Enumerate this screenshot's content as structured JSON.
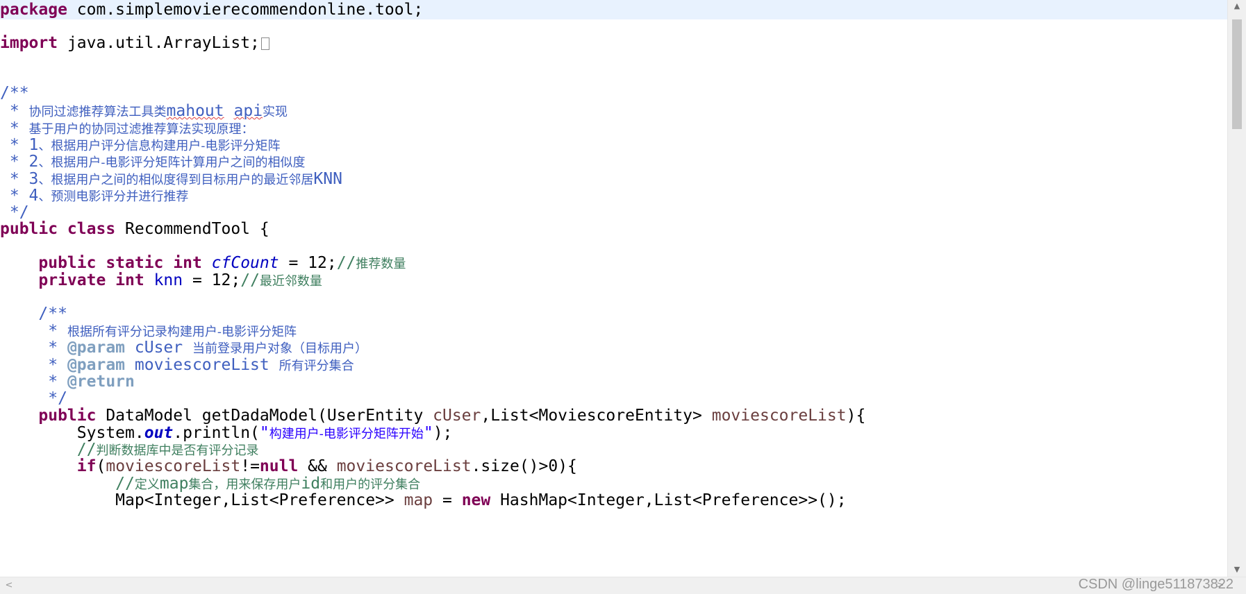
{
  "code": {
    "package_kw": "package",
    "package_name": " com.simplemovierecommendonline.tool;",
    "import_kw": "import",
    "import_name": " java.util.ArrayList;",
    "doc_open": "/**",
    "doc_line1_prefix": " * ",
    "doc_line1_cjk1": "协同过滤推荐算法工具类",
    "doc_line1_word1": "mahout",
    "doc_line1_space": " ",
    "doc_line1_word2": "api",
    "doc_line1_cjk2": "实现",
    "doc_line2_prefix": " * ",
    "doc_line2_cjk": "基于用户的协同过滤推荐算法实现原理：",
    "doc_line3_prefix": " * 1",
    "doc_line3_cjk": "、根据用户评分信息构建用户-电影评分矩阵",
    "doc_line4_prefix": " * 2",
    "doc_line4_cjk": "、根据用户-电影评分矩阵计算用户之间的相似度",
    "doc_line5_prefix": " * 3",
    "doc_line5_cjk": "、根据用户之间的相似度得到目标用户的最近邻居",
    "doc_line5_suffix": "KNN",
    "doc_line6_prefix": " * 4",
    "doc_line6_cjk": "、预测电影评分并进行推荐",
    "doc_close": " */",
    "class_kw": "public class",
    "class_name": " RecommendTool {",
    "field1_kw": "public static int",
    "field1_name": "cfCount",
    "field1_rest": " = 12;",
    "field1_comment_slash": "//",
    "field1_comment": "推荐数量",
    "field2_kw": "private int",
    "field2_name": "knn",
    "field2_rest": " = 12;",
    "field2_comment_slash": "//",
    "field2_comment": "最近邻数量",
    "mdoc_open": "/**",
    "mdoc_line1_prefix": " * ",
    "mdoc_line1_cjk": "根据所有评分记录构建用户-电影评分矩阵",
    "mdoc_param1_star": " * ",
    "mdoc_param1_tag": "@param",
    "mdoc_param1_name": " cUser ",
    "mdoc_param1_desc": "当前登录用户对象（目标用户）",
    "mdoc_param2_star": " * ",
    "mdoc_param2_tag": "@param",
    "mdoc_param2_name": " moviescoreList ",
    "mdoc_param2_desc": "所有评分集合",
    "mdoc_return_star": " * ",
    "mdoc_return_tag": "@return",
    "mdoc_close": " */",
    "method_kw": "public",
    "method_sig1": " DataModel getDadaModel(UserEntity ",
    "method_param1": "cUser",
    "method_sig2": ",List<MoviescoreEntity> ",
    "method_param2": "moviescoreList",
    "method_sig3": "){",
    "println_pre": "System.",
    "println_out": "out",
    "println_mid": ".println(",
    "println_str_q1": "\"",
    "println_str": "构建用户-电影评分矩阵开始",
    "println_str_q2": "\"",
    "println_end": ");",
    "comment1_slash": "//",
    "comment1_text": "判断数据库中是否有评分记录",
    "if_kw": "if",
    "if_open": "(",
    "if_var1": "moviescoreList",
    "if_neq": "!=",
    "if_null": "null",
    "if_and": " && ",
    "if_var2": "moviescoreList",
    "if_rest": ".size()>0){",
    "comment2_slash": "//",
    "comment2_cjk1": "定义",
    "comment2_word1": "map",
    "comment2_cjk2": "集合，用来保存用户",
    "comment2_word2": "id",
    "comment2_cjk3": "和用户的评分集合",
    "map_line_pre": "Map<Integer,List<Preference>> ",
    "map_line_var": "map",
    "map_line_eq": " = ",
    "map_line_new": "new",
    "map_line_rest": " HashMap<Integer,List<Preference>>();"
  },
  "watermark": "CSDN @linge511873822",
  "scroll": {
    "up_icon": "▲",
    "down_icon": "▼",
    "left_icon": "<",
    "right_icon": ">"
  }
}
